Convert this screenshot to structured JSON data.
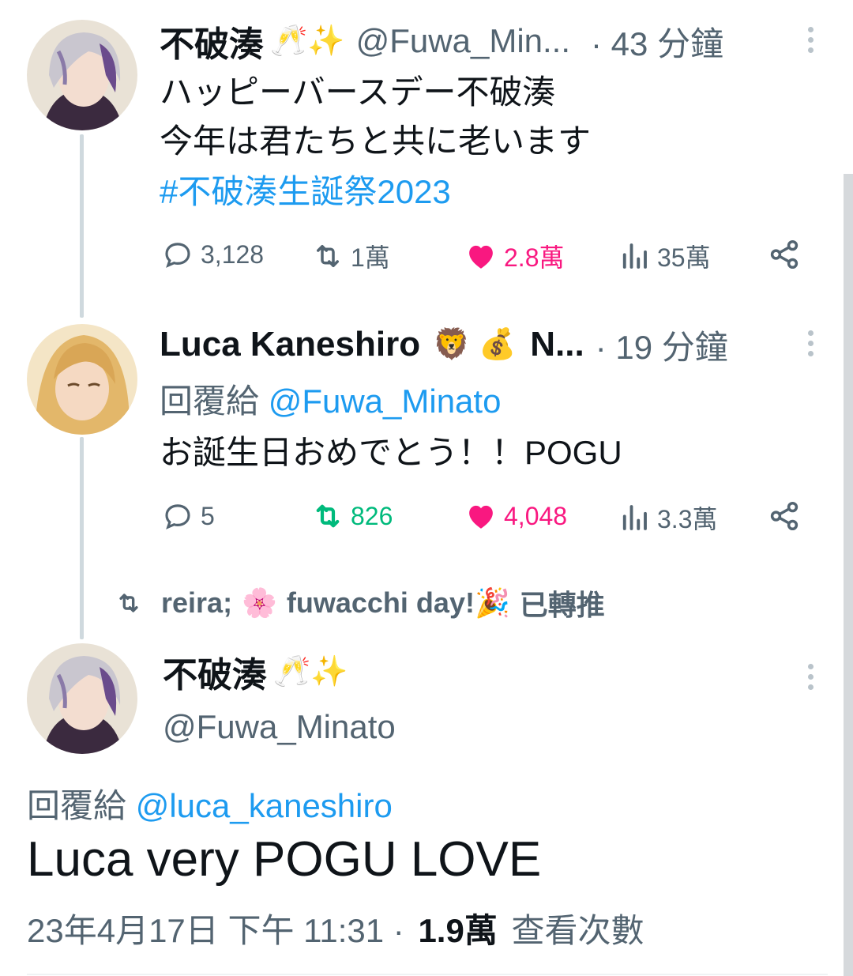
{
  "tweet1": {
    "name": "不破湊",
    "emoji": "🥂✨",
    "handle": "@Fuwa_Min...",
    "time": "· 43 分鐘",
    "lines": [
      "ハッピーバースデー不破湊",
      "今年は君たちと共に老います"
    ],
    "hashtag": "#不破湊生誕祭2023",
    "replies": "3,128",
    "retweets": "1萬",
    "likes": "2.8萬",
    "views": "35萬"
  },
  "tweet2": {
    "name": "Luca Kaneshiro",
    "emoji": "🦁 💰",
    "name_tail": "N...",
    "time": "· 19 分鐘",
    "reply_prefix": "回覆給",
    "reply_to": "@Fuwa_Minato",
    "text": "お誕生日おめでとう！！POGU",
    "replies": "5",
    "retweets": "826",
    "likes": "4,048",
    "views": "3.3萬"
  },
  "retweet_banner": {
    "user": "reira;",
    "user_emoji": "🌸",
    "tail": "fuwacchi day!",
    "tail_emoji": "🎉",
    "suffix": "已轉推"
  },
  "main_tweet": {
    "name": "不破湊",
    "emoji": "🥂✨",
    "handle": "@Fuwa_Minato",
    "reply_prefix": "回覆給",
    "reply_to": "@luca_kaneshiro",
    "text": "Luca very POGU LOVE",
    "date": "23年4月17日 下午 11:31 ·",
    "views_count": "1.9萬",
    "views_label": "查看次數"
  },
  "colors": {
    "like": "#f91880",
    "retweet_active": "#00ba7c",
    "link": "#1d9bf0",
    "secondary": "#536471"
  },
  "icons": [
    "reply-icon",
    "retweet-icon",
    "heart-icon",
    "views-icon",
    "share-icon",
    "more-icon"
  ]
}
